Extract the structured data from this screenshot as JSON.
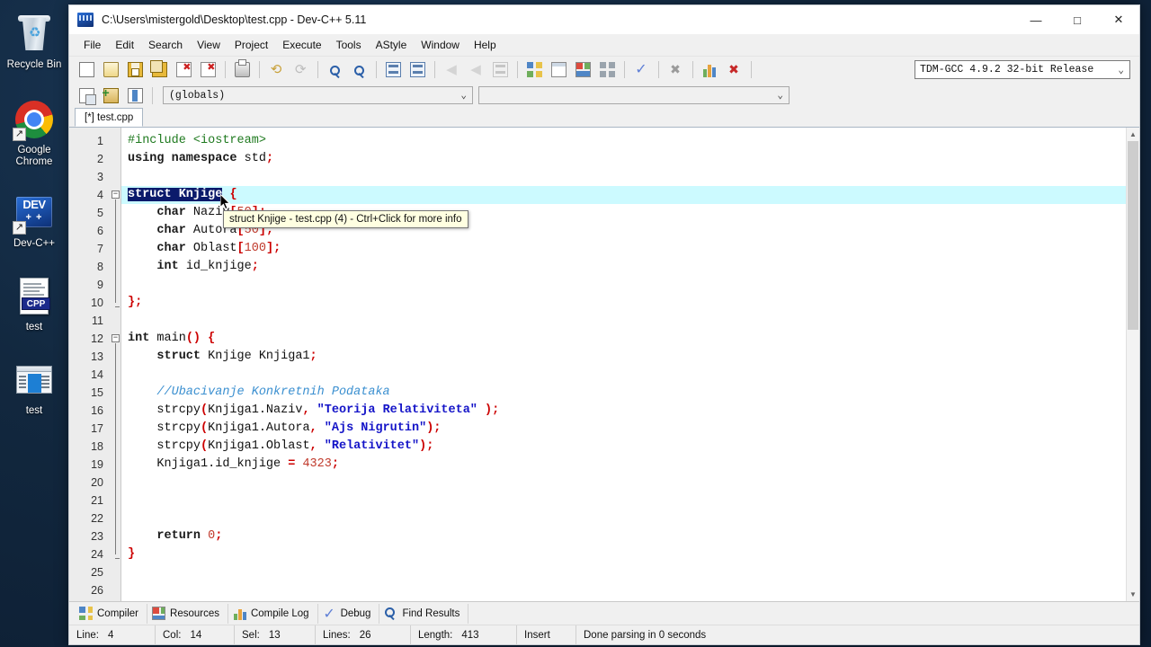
{
  "desktop": {
    "icons": [
      {
        "label": "Recycle Bin",
        "icon": "recycle-bin-icon",
        "shortcut": false
      },
      {
        "label": "Google Chrome",
        "icon": "chrome-icon",
        "shortcut": true
      },
      {
        "label": "Dev-C++",
        "icon": "dev-cpp-icon",
        "shortcut": true
      },
      {
        "label": "test",
        "icon": "cpp-file-icon",
        "shortcut": false
      },
      {
        "label": "test",
        "icon": "executable-icon",
        "shortcut": false
      }
    ]
  },
  "window": {
    "title": "C:\\Users\\mistergold\\Desktop\\test.cpp - Dev-C++ 5.11",
    "minimize": "—",
    "maximize": "□",
    "close": "✕"
  },
  "menubar": {
    "items": [
      "File",
      "Edit",
      "Search",
      "View",
      "Project",
      "Execute",
      "Tools",
      "AStyle",
      "Window",
      "Help"
    ]
  },
  "toolbar": {
    "buttons": [
      {
        "name": "new-file-button",
        "icon": "new-page-icon"
      },
      {
        "name": "open-file-button",
        "icon": "open-folder-icon"
      },
      {
        "name": "save-file-button",
        "icon": "floppy-save-icon"
      },
      {
        "name": "save-all-button",
        "icon": "save-all-icon"
      },
      {
        "name": "close-file-button",
        "icon": "close-file-icon"
      },
      {
        "name": "close-all-button",
        "icon": "close-all-icon"
      },
      {
        "name": "print-button",
        "icon": "printer-icon"
      },
      {
        "name": "undo-button",
        "icon": "undo-arrow-icon"
      },
      {
        "name": "redo-button",
        "icon": "redo-arrow-icon"
      },
      {
        "name": "find-button",
        "icon": "magnifier-icon"
      },
      {
        "name": "replace-button",
        "icon": "magnifier-replace-icon"
      },
      {
        "name": "goto-line-button",
        "icon": "goto-line-icon"
      },
      {
        "name": "goto-function-button",
        "icon": "goto-function-icon"
      },
      {
        "name": "back-button",
        "icon": "back-arrow-icon"
      },
      {
        "name": "forward-button",
        "icon": "forward-arrow-icon"
      },
      {
        "name": "insert-button",
        "icon": "insert-icon"
      },
      {
        "name": "compile-button",
        "icon": "compile-icon"
      },
      {
        "name": "run-button",
        "icon": "run-window-icon"
      },
      {
        "name": "compile-run-button",
        "icon": "compile-run-icon"
      },
      {
        "name": "rebuild-all-button",
        "icon": "rebuild-all-icon"
      },
      {
        "name": "syntax-check-button",
        "icon": "check-mark-icon"
      },
      {
        "name": "stop-execution-button",
        "icon": "stop-icon"
      },
      {
        "name": "profile-button",
        "icon": "bar-chart-icon"
      },
      {
        "name": "debug-button",
        "icon": "debug-bug-icon"
      }
    ],
    "compiler_set": "TDM-GCC 4.9.2 32-bit Release",
    "chevron": "⌄"
  },
  "toolbar2": {
    "buttons": [
      {
        "name": "new-project-button",
        "icon": "project-icon"
      },
      {
        "name": "add-to-project-button",
        "icon": "add-file-icon"
      },
      {
        "name": "project-view-button",
        "icon": "project-view-icon"
      }
    ],
    "scope_combo": "(globals)",
    "symbol_combo": "",
    "chevron": "⌄"
  },
  "tabs": {
    "open_file": "[*] test.cpp"
  },
  "editor": {
    "current_line": 4,
    "line_count": 26,
    "lines": [
      {
        "n": 1,
        "tokens": [
          {
            "t": "#include <iostream>",
            "c": "pp"
          }
        ]
      },
      {
        "n": 2,
        "tokens": [
          {
            "t": "using namespace ",
            "c": "kw"
          },
          {
            "t": "std",
            "c": ""
          },
          {
            "t": ";",
            "c": "punct"
          }
        ]
      },
      {
        "n": 3,
        "tokens": []
      },
      {
        "n": 4,
        "tokens": [
          {
            "t": "struct Knjige",
            "c": "sel-kw"
          },
          {
            "t": " ",
            "c": ""
          },
          {
            "t": "{",
            "c": "punct"
          }
        ]
      },
      {
        "n": 5,
        "tokens": [
          {
            "t": "    char",
            "c": "kw"
          },
          {
            "t": " Naziv",
            "c": ""
          },
          {
            "t": "[",
            "c": "punct"
          },
          {
            "t": "50",
            "c": "num"
          },
          {
            "t": "]",
            "c": "punct"
          },
          {
            "t": ";",
            "c": "punct"
          }
        ]
      },
      {
        "n": 6,
        "tokens": [
          {
            "t": "    char",
            "c": "kw"
          },
          {
            "t": " Autora",
            "c": ""
          },
          {
            "t": "[",
            "c": "punct"
          },
          {
            "t": "50",
            "c": "num"
          },
          {
            "t": "]",
            "c": "punct"
          },
          {
            "t": ";",
            "c": "punct"
          }
        ]
      },
      {
        "n": 7,
        "tokens": [
          {
            "t": "    char",
            "c": "kw"
          },
          {
            "t": " Oblast",
            "c": ""
          },
          {
            "t": "[",
            "c": "punct"
          },
          {
            "t": "100",
            "c": "num"
          },
          {
            "t": "]",
            "c": "punct"
          },
          {
            "t": ";",
            "c": "punct"
          }
        ]
      },
      {
        "n": 8,
        "tokens": [
          {
            "t": "    int",
            "c": "kw"
          },
          {
            "t": " id_knjige",
            "c": ""
          },
          {
            "t": ";",
            "c": "punct"
          }
        ]
      },
      {
        "n": 9,
        "tokens": []
      },
      {
        "n": 10,
        "tokens": [
          {
            "t": "};",
            "c": "punct"
          }
        ]
      },
      {
        "n": 11,
        "tokens": []
      },
      {
        "n": 12,
        "tokens": [
          {
            "t": "int",
            "c": "kw"
          },
          {
            "t": " main",
            "c": ""
          },
          {
            "t": "()",
            "c": "punct"
          },
          {
            "t": " ",
            "c": ""
          },
          {
            "t": "{",
            "c": "punct"
          }
        ]
      },
      {
        "n": 13,
        "tokens": [
          {
            "t": "    struct",
            "c": "kw"
          },
          {
            "t": " Knjige Knjiga1",
            "c": ""
          },
          {
            "t": ";",
            "c": "punct"
          }
        ]
      },
      {
        "n": 14,
        "tokens": []
      },
      {
        "n": 15,
        "tokens": [
          {
            "t": "    //Ubacivanje Konkretnih Podataka",
            "c": "cmt"
          }
        ]
      },
      {
        "n": 16,
        "tokens": [
          {
            "t": "    strcpy",
            "c": ""
          },
          {
            "t": "(",
            "c": "punct"
          },
          {
            "t": "Knjiga1.Naziv",
            "c": ""
          },
          {
            "t": ",",
            "c": "punct"
          },
          {
            "t": " ",
            "c": ""
          },
          {
            "t": "\"Teorija Relativiteta\"",
            "c": "str"
          },
          {
            "t": " ",
            "c": ""
          },
          {
            "t": ");",
            "c": "punct"
          }
        ]
      },
      {
        "n": 17,
        "tokens": [
          {
            "t": "    strcpy",
            "c": ""
          },
          {
            "t": "(",
            "c": "punct"
          },
          {
            "t": "Knjiga1.Autora",
            "c": ""
          },
          {
            "t": ",",
            "c": "punct"
          },
          {
            "t": " ",
            "c": ""
          },
          {
            "t": "\"Ajs Nigrutin\"",
            "c": "str"
          },
          {
            "t": ");",
            "c": "punct"
          }
        ]
      },
      {
        "n": 18,
        "tokens": [
          {
            "t": "    strcpy",
            "c": ""
          },
          {
            "t": "(",
            "c": "punct"
          },
          {
            "t": "Knjiga1.Oblast",
            "c": ""
          },
          {
            "t": ",",
            "c": "punct"
          },
          {
            "t": " ",
            "c": ""
          },
          {
            "t": "\"Relativitet\"",
            "c": "str"
          },
          {
            "t": ");",
            "c": "punct"
          }
        ]
      },
      {
        "n": 19,
        "tokens": [
          {
            "t": "    Knjiga1.id_knjige ",
            "c": ""
          },
          {
            "t": "=",
            "c": "punct"
          },
          {
            "t": " ",
            "c": ""
          },
          {
            "t": "4323",
            "c": "num"
          },
          {
            "t": ";",
            "c": "punct"
          }
        ]
      },
      {
        "n": 20,
        "tokens": []
      },
      {
        "n": 21,
        "tokens": []
      },
      {
        "n": 22,
        "tokens": []
      },
      {
        "n": 23,
        "tokens": [
          {
            "t": "    return",
            "c": "kw"
          },
          {
            "t": " ",
            "c": ""
          },
          {
            "t": "0",
            "c": "num"
          },
          {
            "t": ";",
            "c": "punct"
          }
        ]
      },
      {
        "n": 24,
        "tokens": [
          {
            "t": "}",
            "c": "punct"
          }
        ]
      },
      {
        "n": 25,
        "tokens": []
      },
      {
        "n": 26,
        "tokens": []
      }
    ],
    "tooltip": "struct Knjige - test.cpp (4) - Ctrl+Click for more info"
  },
  "bottom_tabs": [
    {
      "label": "Compiler",
      "icon": "compiler-grid-icon"
    },
    {
      "label": "Resources",
      "icon": "resources-icon"
    },
    {
      "label": "Compile Log",
      "icon": "compile-log-chart-icon"
    },
    {
      "label": "Debug",
      "icon": "debug-check-icon"
    },
    {
      "label": "Find Results",
      "icon": "find-results-magnifier-icon"
    }
  ],
  "statusbar": {
    "line_label": "Line:",
    "line_value": "4",
    "col_label": "Col:",
    "col_value": "14",
    "sel_label": "Sel:",
    "sel_value": "13",
    "lines_label": "Lines:",
    "lines_value": "26",
    "length_label": "Length:",
    "length_value": "413",
    "mode": "Insert",
    "message": "Done parsing in 0 seconds"
  },
  "colors": {
    "accent": "#0b1a6b",
    "current_line": "#ccfaff",
    "string": "#1414c8",
    "keyword": "#1a1a1a",
    "comment": "#3a8fd0",
    "preprocessor": "#1f7a1f",
    "punct": "#cc0000",
    "tooltip_bg": "#ffffe1"
  }
}
